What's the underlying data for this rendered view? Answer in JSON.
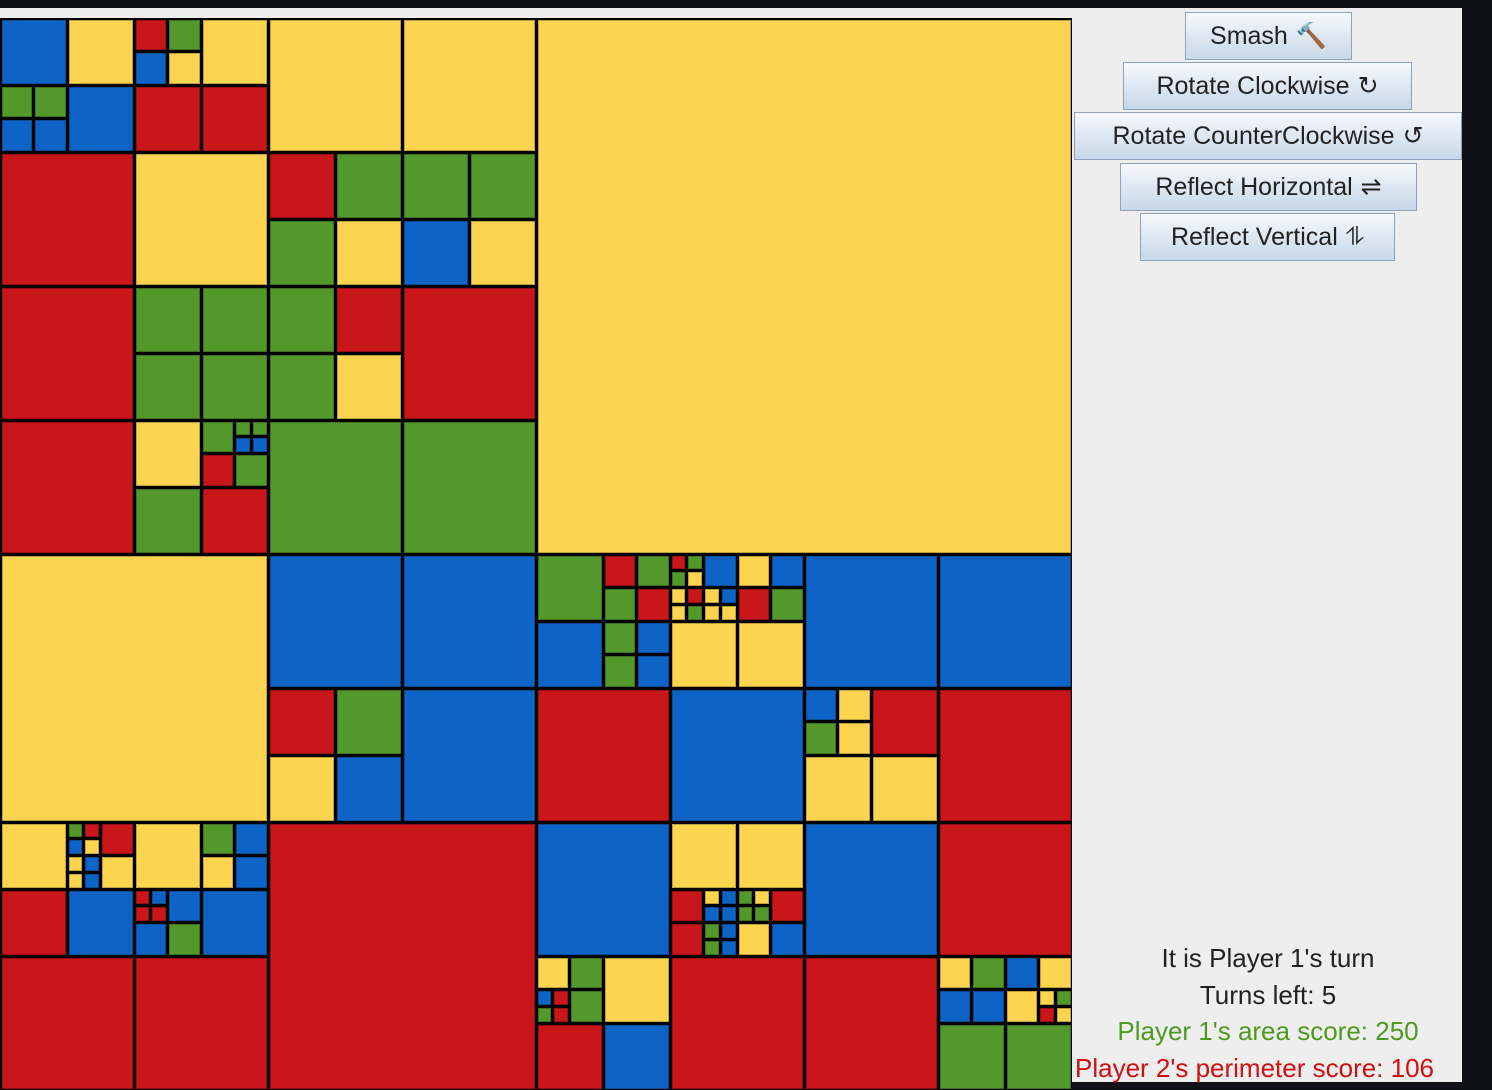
{
  "colors": {
    "R": "#c8161a",
    "G": "#53982a",
    "B": "#0d64c6",
    "Y": "#fdd44f"
  },
  "color_names": {
    "R": "red",
    "G": "green",
    "B": "blue",
    "Y": "yellow"
  },
  "board": [
    [
      [
        [
          "B",
          "Y",
          [
            "G",
            "G",
            "B",
            "B"
          ],
          "B"
        ],
        [
          [
            "R",
            "G",
            "B",
            "Y"
          ],
          "Y",
          "R",
          "R"
        ],
        "R",
        "Y"
      ],
      [
        "Y",
        "Y",
        [
          "R",
          "G",
          "G",
          "Y"
        ],
        [
          "G",
          "G",
          "B",
          "Y"
        ]
      ],
      [
        "R",
        [
          "G",
          "G",
          "G",
          "G"
        ],
        "R",
        [
          "Y",
          [
            "G",
            [
              "G",
              "G",
              "B",
              "B"
            ],
            "R",
            "G"
          ],
          "G",
          "R"
        ]
      ],
      [
        [
          "G",
          "R",
          "G",
          "Y"
        ],
        "R",
        "G",
        "G"
      ]
    ],
    "Y",
    [
      "Y",
      [
        "B",
        "B",
        [
          "R",
          "G",
          "Y",
          "B"
        ],
        "B"
      ],
      [
        [
          "Y",
          [
            [
              "G",
              "R",
              "B",
              "Y"
            ],
            "R",
            [
              "Y",
              "B",
              "Y",
              "B"
            ],
            "Y"
          ],
          "R",
          "B"
        ],
        [
          "Y",
          [
            "G",
            "B",
            "Y",
            "B"
          ],
          [
            [
              "R",
              "B",
              "R",
              "R"
            ],
            "B",
            "B",
            "G"
          ],
          "B"
        ],
        "R",
        "R"
      ],
      "R"
    ],
    [
      [
        [
          "G",
          [
            "R",
            "G",
            "G",
            "R"
          ],
          "B",
          [
            "G",
            "B",
            "G",
            "B"
          ]
        ],
        [
          [
            [
              "R",
              "G",
              "G",
              "Y"
            ],
            "B",
            [
              "Y",
              "R",
              "Y",
              "G"
            ],
            [
              "Y",
              "B",
              "Y",
              "Y"
            ]
          ],
          [
            "Y",
            "B",
            "R",
            "G"
          ],
          "Y",
          "Y"
        ],
        "R",
        "B"
      ],
      [
        "B",
        "B",
        [
          [
            "B",
            "Y",
            "G",
            "Y"
          ],
          "R",
          "Y",
          "Y"
        ],
        "R"
      ],
      [
        "B",
        [
          "Y",
          "Y",
          [
            "R",
            [
              "Y",
              "B",
              "B",
              "B"
            ],
            "R",
            [
              "G",
              "B",
              "G",
              "B"
            ]
          ],
          [
            [
              "G",
              "Y",
              "G",
              "G"
            ],
            "R",
            "Y",
            "B"
          ]
        ],
        [
          [
            "Y",
            "G",
            [
              "B",
              "R",
              "G",
              "R"
            ],
            "G"
          ],
          "Y",
          "R",
          "B"
        ],
        "R"
      ],
      [
        "B",
        "R",
        "R",
        [
          [
            "Y",
            "G",
            "B",
            "B"
          ],
          [
            "B",
            "Y",
            "Y",
            [
              "Y",
              "G",
              "R",
              "Y"
            ]
          ],
          "G",
          "G"
        ]
      ]
    ]
  ],
  "buttons": [
    {
      "label": "Smash",
      "icon": "🔨",
      "icon_name": "hammer-icon"
    },
    {
      "label": "Rotate Clockwise",
      "icon": "↻",
      "icon_name": "rotate-clockwise-icon"
    },
    {
      "label": "Rotate CounterClockwise",
      "icon": "↺",
      "icon_name": "rotate-counterclockwise-icon"
    },
    {
      "label": "Reflect Horizontal",
      "icon": "⇌",
      "icon_name": "reflect-horizontal-icon"
    },
    {
      "label": "Reflect Vertical",
      "icon": "⥮",
      "icon_name": "reflect-vertical-icon"
    }
  ],
  "status": {
    "turn": "It is Player 1's turn",
    "turns_left": "Turns left: 5",
    "player1_score": "Player 1's area score: 250",
    "player2_score": "Player 2's perimeter  score: 106",
    "player1_color": "#4e9a1e",
    "player2_color": "#d01010"
  }
}
